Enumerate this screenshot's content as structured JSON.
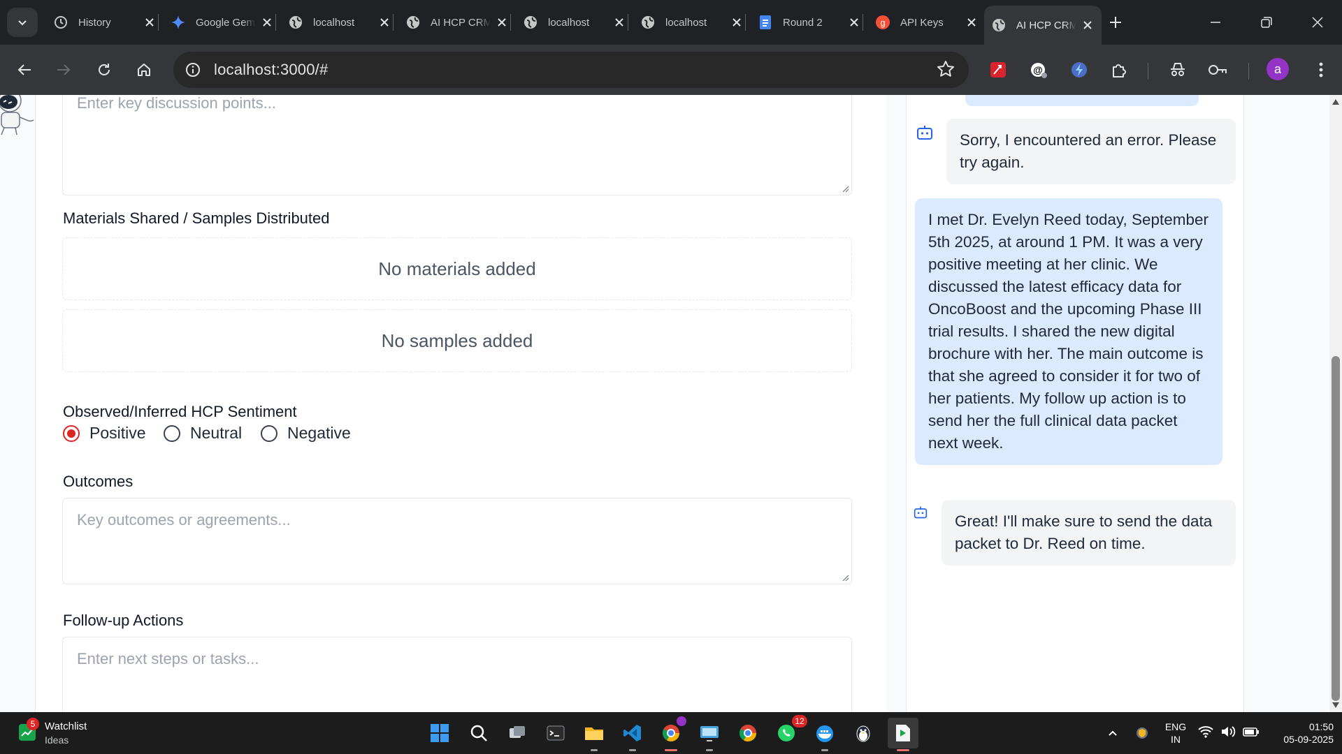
{
  "browser": {
    "tabs": [
      {
        "title": "History",
        "favicon": "history-icon"
      },
      {
        "title": "Google Gemini",
        "favicon": "gemini-icon"
      },
      {
        "title": "localhost",
        "favicon": "globe-icon"
      },
      {
        "title": "AI HCP CRM",
        "favicon": "globe-icon"
      },
      {
        "title": "localhost",
        "favicon": "globe-icon"
      },
      {
        "title": "localhost",
        "favicon": "globe-icon"
      },
      {
        "title": "Round 2",
        "favicon": "docs-icon"
      },
      {
        "title": "API Keys",
        "favicon": "groq-icon"
      },
      {
        "title": "AI HCP CRM",
        "favicon": "globe-icon",
        "active": true
      }
    ],
    "url": "localhost:3000/#",
    "profile_initial": "a"
  },
  "form": {
    "discussion_placeholder": "Enter key discussion points...",
    "materials_label": "Materials Shared / Samples Distributed",
    "materials_empty": "No materials added",
    "samples_empty": "No samples added",
    "sentiment_label": "Observed/Inferred HCP Sentiment",
    "sentiment_options": [
      "Positive",
      "Neutral",
      "Negative"
    ],
    "sentiment_selected": "Positive",
    "outcomes_label": "Outcomes",
    "outcomes_placeholder": "Key outcomes or agreements...",
    "followup_label": "Follow-up Actions",
    "followup_placeholder": "Enter next steps or tasks..."
  },
  "chat": {
    "messages": [
      {
        "role": "bot",
        "text": "Sorry, I encountered an error. Please try again."
      },
      {
        "role": "user",
        "text": "I met Dr. Evelyn Reed today, September 5th 2025, at around 1 PM. It was a very positive meeting at her clinic. We discussed the latest efficacy data for OncoBoost and the upcoming Phase III trial results. I shared the new digital brochure with her. The main outcome is that she agreed to consider it for two of her patients. My follow up action is to send her the full clinical data packet next week."
      },
      {
        "role": "bot",
        "text": "Great! I'll make sure to send the data packet to Dr. Reed on time."
      }
    ]
  },
  "taskbar": {
    "widget_title": "Watchlist",
    "widget_subtitle": "Ideas",
    "widget_badge": "5",
    "whatsapp_badge": "12",
    "lang_line1": "ENG",
    "lang_line2": "IN",
    "time": "01:50",
    "date": "05-09-2025"
  },
  "colors": {
    "accent_red": "#dc2626",
    "user_bubble": "#dbeafe",
    "bot_bubble": "#f3f4f6"
  }
}
